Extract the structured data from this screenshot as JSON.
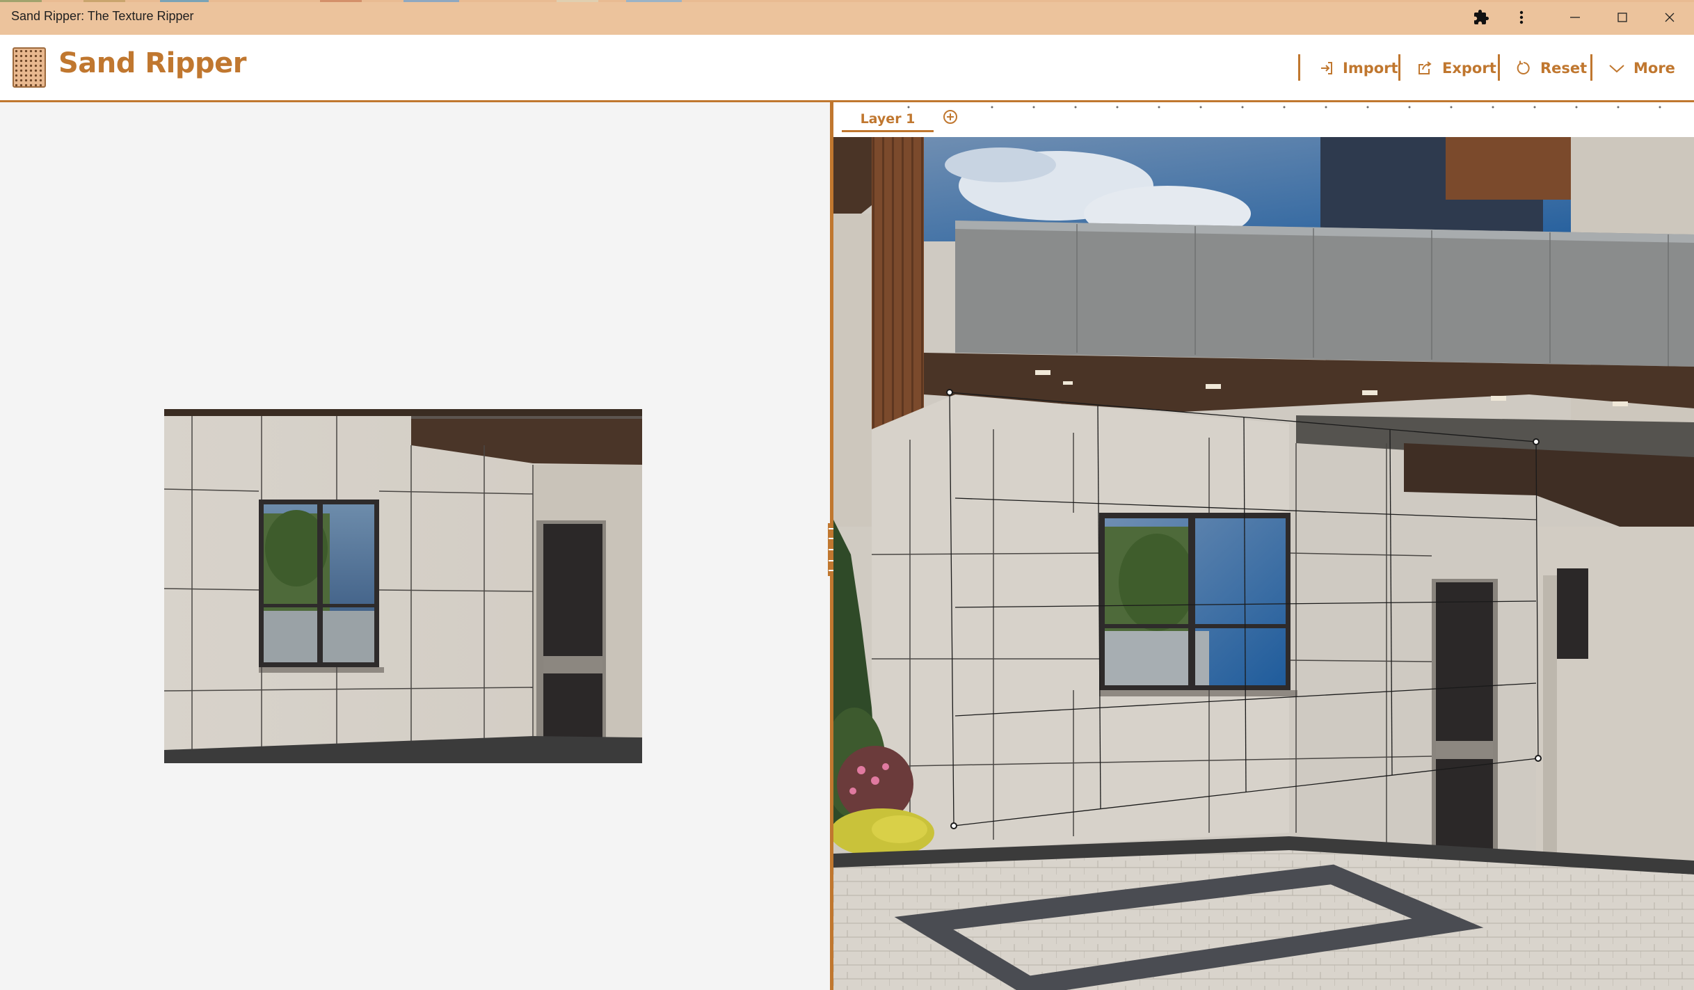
{
  "window": {
    "title": "Sand Ripper: The Texture Ripper",
    "extensions_icon": "puzzle-icon",
    "menu_icon": "vertical-dots-icon",
    "minimize_icon": "minimize-icon",
    "maximize_icon": "maximize-icon",
    "close_icon": "close-icon"
  },
  "app": {
    "name": "Sand Ripper",
    "logo_icon": "sand-texture-logo"
  },
  "toolbar": {
    "import_label": "Import",
    "export_label": "Export",
    "reset_label": "Reset",
    "more_label": "More"
  },
  "layers": {
    "tabs": [
      {
        "label": "Layer 1",
        "active": true
      }
    ],
    "add_icon": "plus-circle-icon"
  },
  "colors": {
    "accent": "#c0772f",
    "titlebar": "#ecc39c",
    "pane_background": "#f4f4f4"
  }
}
